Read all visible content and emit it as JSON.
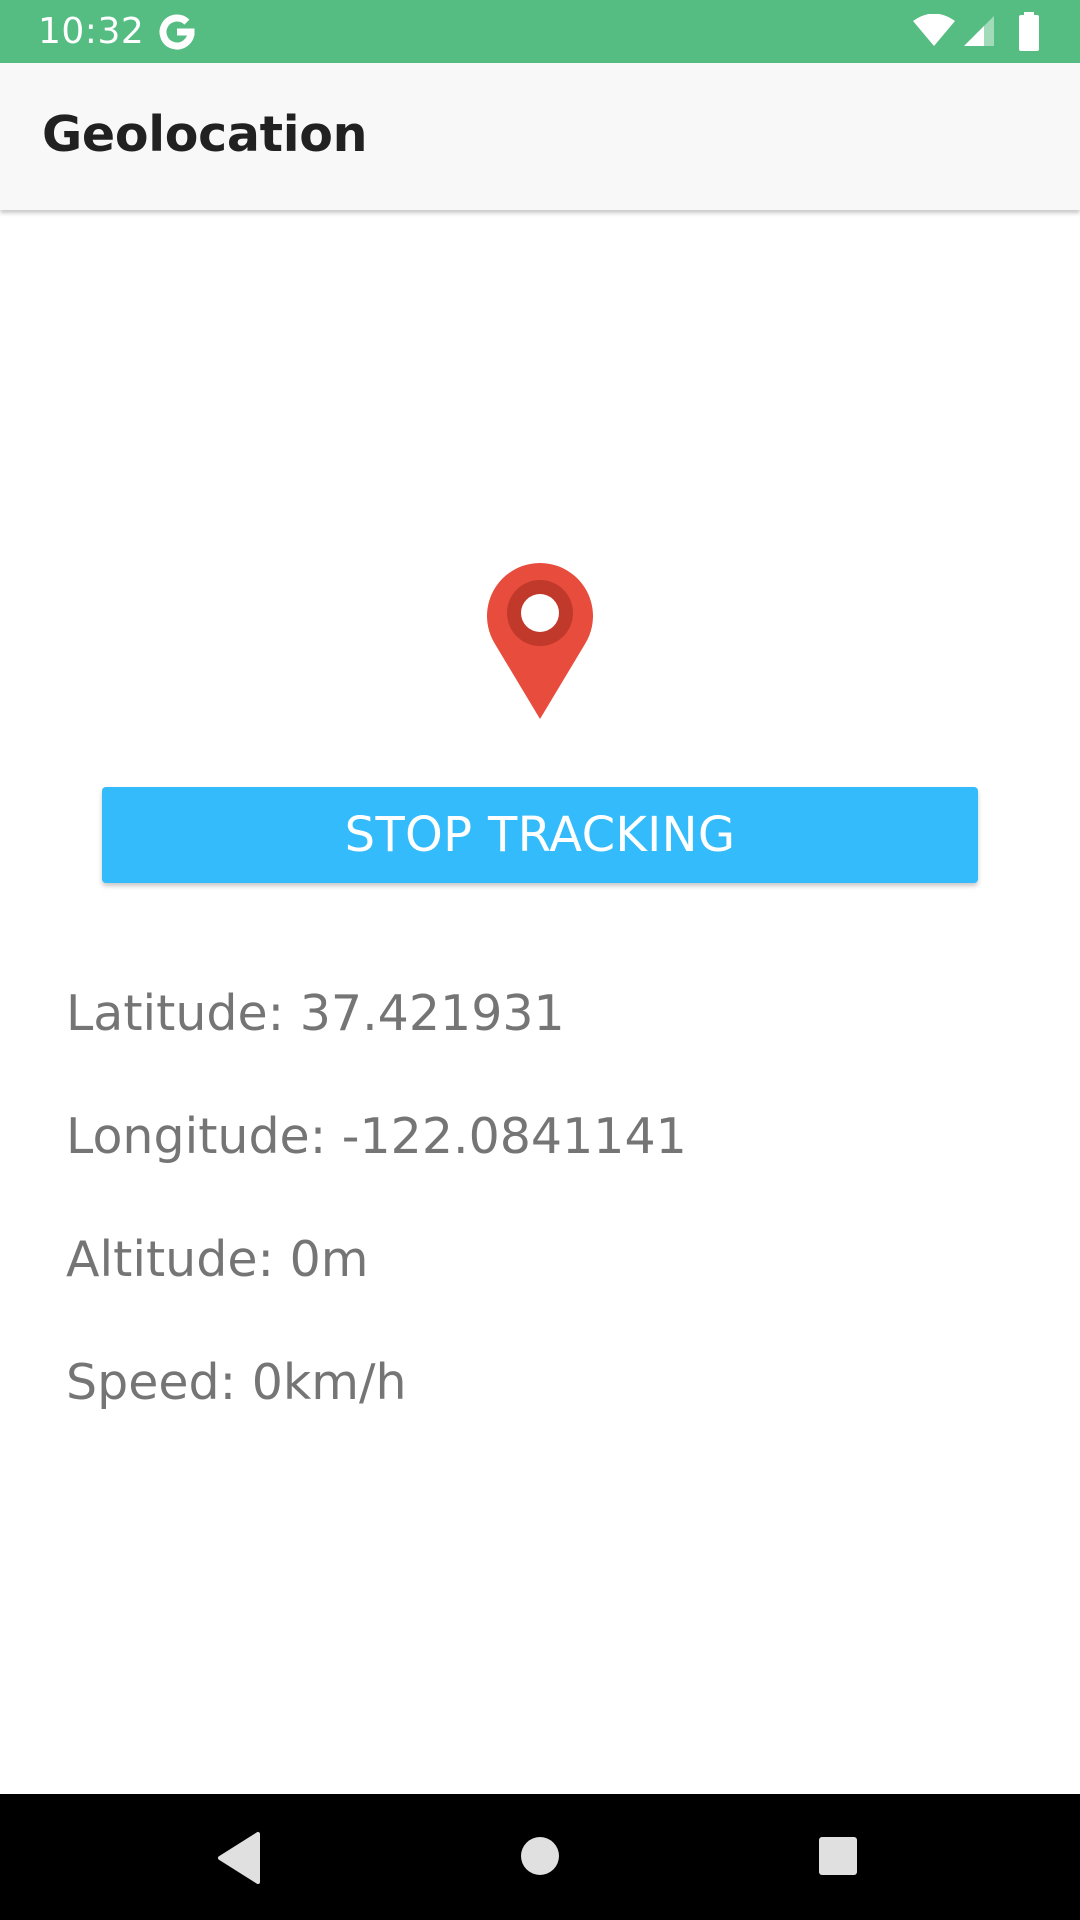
{
  "status_bar": {
    "time": "10:32",
    "color": "#55bd82",
    "icons": [
      "google-g-icon",
      "wifi-icon",
      "cell-signal-icon",
      "battery-icon"
    ]
  },
  "app_bar": {
    "title": "Geolocation"
  },
  "main": {
    "pin_icon": "location-pin-icon",
    "pin_color": "#e74c3c",
    "stop_button_label": "STOP TRACKING",
    "button_color": "#33bbfb",
    "latitude": "Latitude: 37.421931",
    "longitude": "Longitude: -122.0841141",
    "altitude": "Altitude: 0m",
    "speed": "Speed: 0km/h"
  },
  "nav_bar": {
    "buttons": [
      "back-icon",
      "home-icon",
      "recents-icon"
    ]
  }
}
